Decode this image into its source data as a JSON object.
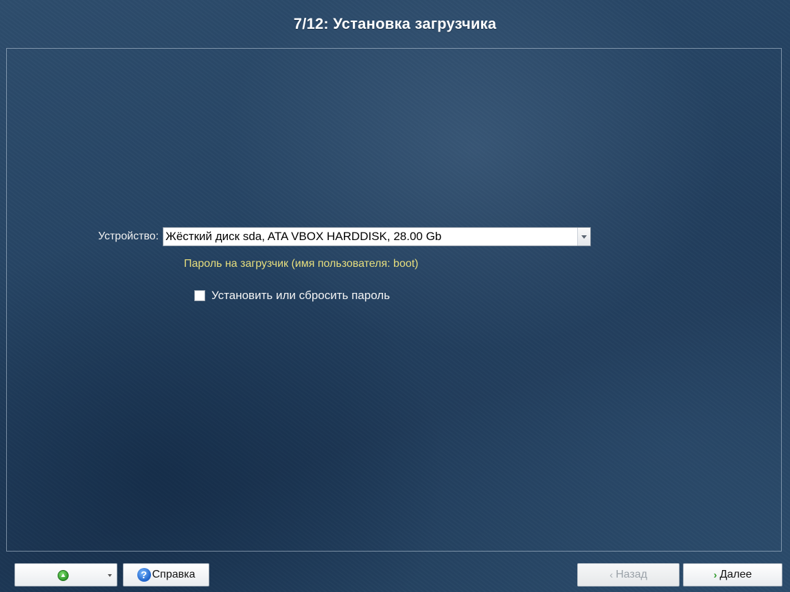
{
  "window": {
    "title": "7/12: Установка загрузчика"
  },
  "device": {
    "label": "Устройство:",
    "selected": "Жёсткий диск sda, ATA VBOX HARDDISK, 28.00 Gb"
  },
  "password": {
    "hint": "Пароль на загрузчик (имя пользователя: boot)",
    "checkbox_label": "Установить или сбросить пароль",
    "checked": false
  },
  "footer": {
    "help_label": "Справка",
    "back_label": "Назад",
    "next_label": "Далее"
  },
  "colors": {
    "hint_text": "#e8df7e",
    "background": "#233f5e"
  },
  "icons": {
    "action": "green-up-arrow-icon",
    "help": "help-question-icon",
    "back": "chevron-left-icon",
    "next": "chevron-right-icon"
  }
}
